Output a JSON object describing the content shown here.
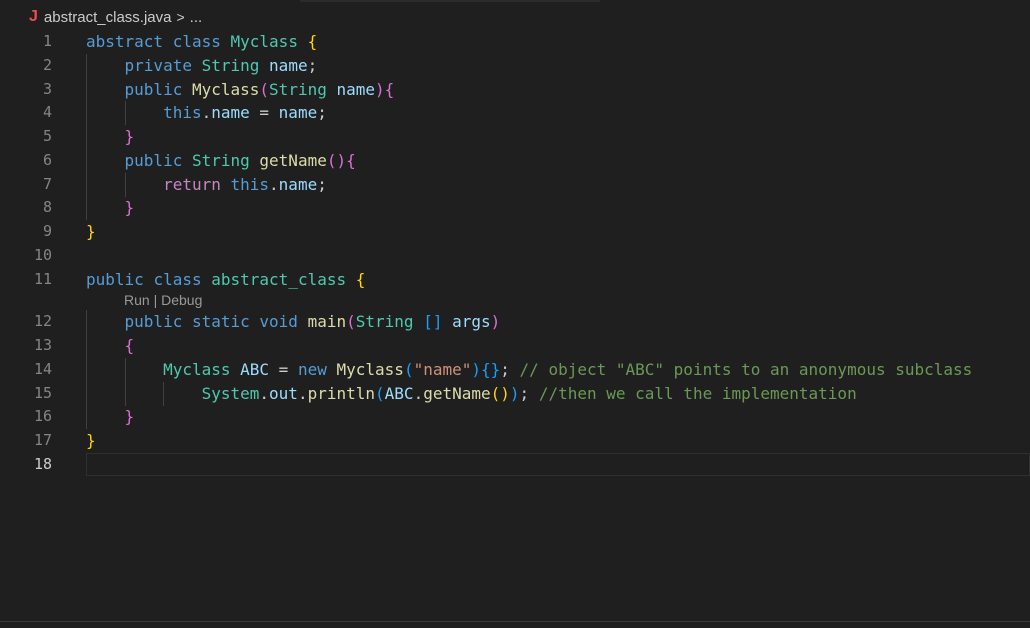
{
  "breadcrumb": {
    "icon_letter": "J",
    "file": "abstract_class.java",
    "separator": ">",
    "more": "..."
  },
  "colors": {
    "background": "#1f1f1f",
    "keyword": "#569cd6",
    "type": "#4ec9b0",
    "function": "#dcdcaa",
    "variable": "#9cdcfe",
    "string": "#ce9178",
    "comment": "#6a9955"
  },
  "codelens": {
    "run": "Run",
    "sep": " | ",
    "debug": "Debug"
  },
  "lines": [
    {
      "no": "1",
      "tokens": [
        [
          "kw",
          "abstract"
        ],
        [
          "",
          " "
        ],
        [
          "kw",
          "class"
        ],
        [
          "",
          " "
        ],
        [
          "ty",
          "Myclass"
        ],
        [
          "",
          " "
        ],
        [
          "b1",
          "{"
        ]
      ]
    },
    {
      "no": "2",
      "tokens": [
        [
          "",
          "    "
        ],
        [
          "kw",
          "private"
        ],
        [
          "",
          " "
        ],
        [
          "ty",
          "String"
        ],
        [
          "",
          " "
        ],
        [
          "var",
          "name"
        ],
        [
          "",
          ";"
        ]
      ]
    },
    {
      "no": "3",
      "tokens": [
        [
          "",
          "    "
        ],
        [
          "kw",
          "public"
        ],
        [
          "",
          " "
        ],
        [
          "fn",
          "Myclass"
        ],
        [
          "b2",
          "("
        ],
        [
          "ty",
          "String"
        ],
        [
          "",
          " "
        ],
        [
          "var",
          "name"
        ],
        [
          "b2",
          ")"
        ],
        [
          "b2",
          "{"
        ]
      ]
    },
    {
      "no": "4",
      "tokens": [
        [
          "",
          "        "
        ],
        [
          "kw",
          "this"
        ],
        [
          "",
          "."
        ],
        [
          "var",
          "name"
        ],
        [
          "",
          " = "
        ],
        [
          "var",
          "name"
        ],
        [
          "",
          ";"
        ]
      ]
    },
    {
      "no": "5",
      "tokens": [
        [
          "",
          "    "
        ],
        [
          "b2",
          "}"
        ]
      ]
    },
    {
      "no": "6",
      "tokens": [
        [
          "",
          "    "
        ],
        [
          "kw",
          "public"
        ],
        [
          "",
          " "
        ],
        [
          "ty",
          "String"
        ],
        [
          "",
          " "
        ],
        [
          "fn",
          "getName"
        ],
        [
          "b2",
          "()"
        ],
        [
          "b2",
          "{"
        ]
      ]
    },
    {
      "no": "7",
      "tokens": [
        [
          "",
          "        "
        ],
        [
          "ctl",
          "return"
        ],
        [
          "",
          " "
        ],
        [
          "kw",
          "this"
        ],
        [
          "",
          "."
        ],
        [
          "var",
          "name"
        ],
        [
          "",
          ";"
        ]
      ]
    },
    {
      "no": "8",
      "tokens": [
        [
          "",
          "    "
        ],
        [
          "b2",
          "}"
        ]
      ]
    },
    {
      "no": "9",
      "tokens": [
        [
          "b1",
          "}"
        ]
      ]
    },
    {
      "no": "10",
      "tokens": []
    },
    {
      "no": "11",
      "tokens": [
        [
          "kw",
          "public"
        ],
        [
          "",
          " "
        ],
        [
          "kw",
          "class"
        ],
        [
          "",
          " "
        ],
        [
          "ty",
          "abstract_class"
        ],
        [
          "",
          " "
        ],
        [
          "b1",
          "{"
        ]
      ]
    },
    {
      "no": "12",
      "tokens": [
        [
          "",
          "    "
        ],
        [
          "kw",
          "public"
        ],
        [
          "",
          " "
        ],
        [
          "kw",
          "static"
        ],
        [
          "",
          " "
        ],
        [
          "kw",
          "void"
        ],
        [
          "",
          " "
        ],
        [
          "fn",
          "main"
        ],
        [
          "b2",
          "("
        ],
        [
          "ty",
          "String"
        ],
        [
          "",
          " "
        ],
        [
          "b3",
          "[]"
        ],
        [
          "",
          " "
        ],
        [
          "var",
          "args"
        ],
        [
          "b2",
          ")"
        ]
      ]
    },
    {
      "no": "13",
      "tokens": [
        [
          "",
          "    "
        ],
        [
          "b2",
          "{"
        ]
      ]
    },
    {
      "no": "14",
      "tokens": [
        [
          "",
          "        "
        ],
        [
          "ty",
          "Myclass"
        ],
        [
          "",
          " "
        ],
        [
          "var",
          "ABC"
        ],
        [
          "",
          " = "
        ],
        [
          "kw",
          "new"
        ],
        [
          "",
          " "
        ],
        [
          "fn",
          "Myclass"
        ],
        [
          "b3",
          "("
        ],
        [
          "str",
          "\"name\""
        ],
        [
          "b3",
          ")"
        ],
        [
          "b3",
          "{}"
        ],
        [
          "",
          "; "
        ],
        [
          "cm",
          "// object \"ABC\" points to an anonymous subclass"
        ]
      ]
    },
    {
      "no": "15",
      "tokens": [
        [
          "",
          "            "
        ],
        [
          "ty",
          "System"
        ],
        [
          "",
          "."
        ],
        [
          "var",
          "out"
        ],
        [
          "",
          "."
        ],
        [
          "fn",
          "println"
        ],
        [
          "b3",
          "("
        ],
        [
          "var",
          "ABC"
        ],
        [
          "",
          "."
        ],
        [
          "fn",
          "getName"
        ],
        [
          "b1",
          "()"
        ],
        [
          "b3",
          ")"
        ],
        [
          "",
          "; "
        ],
        [
          "cm",
          "//then we call the implementation"
        ]
      ]
    },
    {
      "no": "16",
      "tokens": [
        [
          "",
          "    "
        ],
        [
          "b2",
          "}"
        ]
      ]
    },
    {
      "no": "17",
      "tokens": [
        [
          "b1",
          "}"
        ]
      ]
    },
    {
      "no": "18",
      "tokens": []
    }
  ]
}
